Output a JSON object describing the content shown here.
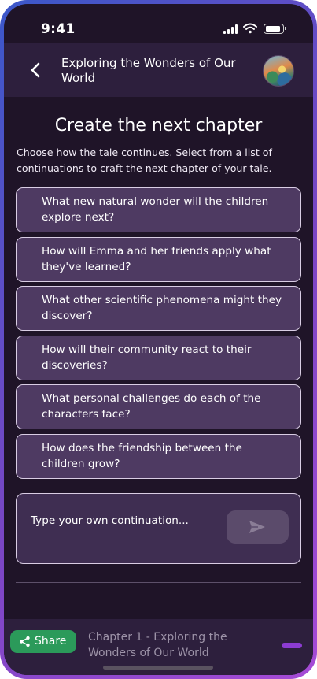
{
  "status_bar": {
    "time": "9:41"
  },
  "header": {
    "title": "Exploring the Wonders of Our World"
  },
  "page": {
    "heading": "Create the next chapter",
    "description": "Choose how the tale continues. Select from a list of continuations to craft the next chapter of your tale."
  },
  "options": [
    {
      "label": "What new natural wonder will the children explore next?"
    },
    {
      "label": "How will Emma and her friends apply what they've learned?"
    },
    {
      "label": "What other scientific phenomena might they discover?"
    },
    {
      "label": "How will their community react to their discoveries?"
    },
    {
      "label": "What personal challenges do each of the characters face?"
    },
    {
      "label": "How does the friendship between the children grow?"
    }
  ],
  "compose": {
    "placeholder": "Type your own continuation..."
  },
  "bottom_bar": {
    "share_label": "Share",
    "chapter_label": "Chapter 1 - Exploring the Wonders of Our World"
  },
  "icons": {
    "back": "chevron-left-icon",
    "send": "send-icon",
    "share": "share-icon",
    "signal": "signal-icon",
    "wifi": "wifi-icon",
    "battery": "battery-icon"
  },
  "colors": {
    "background": "#1f1428",
    "header": "#2d1f3d",
    "option_fill": "#4e3a62",
    "share_button": "#2b9a5a",
    "progress_accent": "#8c3cd2"
  }
}
